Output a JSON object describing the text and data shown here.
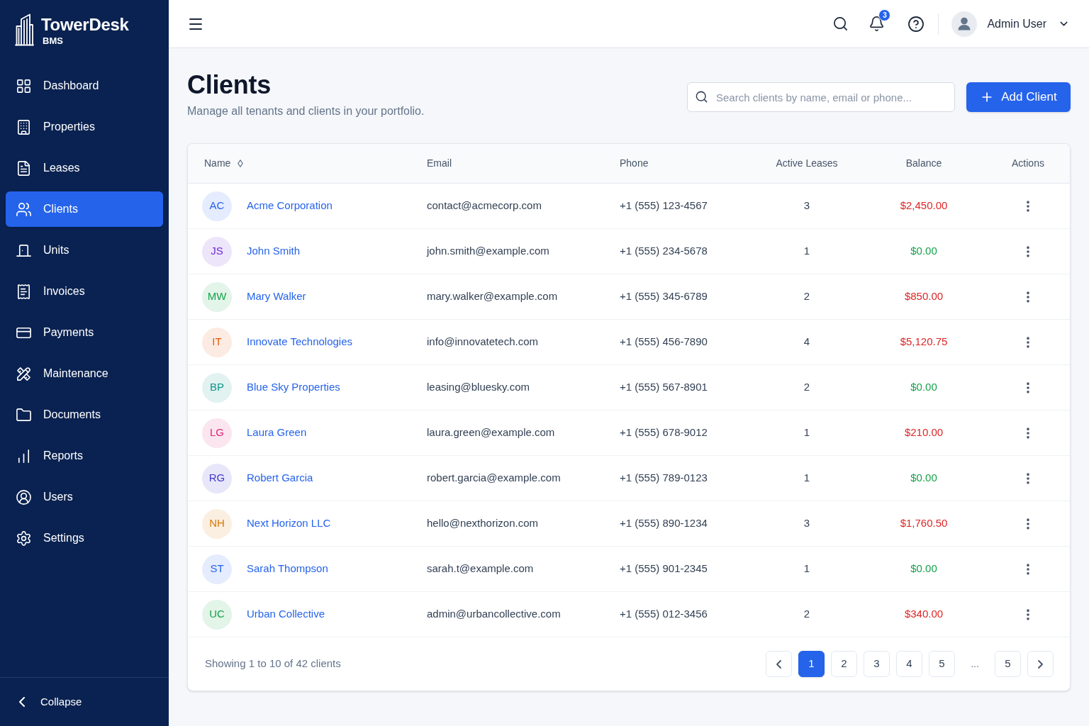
{
  "sidebar": {
    "brand": {
      "name": "TowerDesk",
      "subtitle": "BMS"
    },
    "items": [
      {
        "label": "Dashboard",
        "selected": false
      },
      {
        "label": "Properties",
        "selected": false
      },
      {
        "label": "Leases",
        "selected": false
      },
      {
        "label": "Clients",
        "selected": true
      },
      {
        "label": "Units",
        "selected": false
      },
      {
        "label": "Invoices",
        "selected": false
      },
      {
        "label": "Payments",
        "selected": false
      },
      {
        "label": "Maintenance",
        "selected": false
      },
      {
        "label": "Documents",
        "selected": false
      },
      {
        "label": "Reports",
        "selected": false
      },
      {
        "label": "Users",
        "selected": false
      },
      {
        "label": "Settings",
        "selected": false
      }
    ],
    "collapse": {
      "label": "Collapse"
    }
  },
  "header": {
    "notification_count": "3",
    "user": {
      "name": "Admin User"
    }
  },
  "page": {
    "title": "Clients",
    "subtitle": "Manage all tenants and clients in your portfolio.",
    "search": {
      "placeholder": "Search clients by name, email or phone..."
    },
    "add_button": {
      "label": "Add Client"
    }
  },
  "table": {
    "columns": [
      {
        "label": "Name",
        "sortable": true
      },
      {
        "label": "Email",
        "sortable": false
      },
      {
        "label": "Phone",
        "sortable": false
      },
      {
        "label": "Active Leases",
        "sortable": false
      },
      {
        "label": "Balance",
        "sortable": false
      },
      {
        "label": "Actions",
        "sortable": false
      }
    ],
    "rows": [
      {
        "initials": "AC",
        "color": "#2563eb",
        "name": "Acme Corporation",
        "email": "contact@acmecorp.com",
        "phone": "+1 (555) 123-4567",
        "active_leases": "3",
        "balance": "$2,450.00",
        "outstanding": true
      },
      {
        "initials": "JS",
        "color": "#6d28d9",
        "name": "John Smith",
        "email": "john.smith@example.com",
        "phone": "+1 (555) 234-5678",
        "active_leases": "1",
        "balance": "$0.00",
        "outstanding": false
      },
      {
        "initials": "MW",
        "color": "#16a34a",
        "name": "Mary Walker",
        "email": "mary.walker@example.com",
        "phone": "+1 (555) 345-6789",
        "active_leases": "2",
        "balance": "$850.00",
        "outstanding": true
      },
      {
        "initials": "IT",
        "color": "#ea580c",
        "name": "Innovate Technologies",
        "email": "info@innovatetech.com",
        "phone": "+1 (555) 456-7890",
        "active_leases": "4",
        "balance": "$5,120.75",
        "outstanding": true
      },
      {
        "initials": "BP",
        "color": "#0d9488",
        "name": "Blue Sky Properties",
        "email": "leasing@bluesky.com",
        "phone": "+1 (555) 567-8901",
        "active_leases": "2",
        "balance": "$0.00",
        "outstanding": false
      },
      {
        "initials": "LG",
        "color": "#db2777",
        "name": "Laura Green",
        "email": "laura.green@example.com",
        "phone": "+1 (555) 678-9012",
        "active_leases": "1",
        "balance": "$210.00",
        "outstanding": true
      },
      {
        "initials": "RG",
        "color": "#4338ca",
        "name": "Robert Garcia",
        "email": "robert.garcia@example.com",
        "phone": "+1 (555) 789-0123",
        "active_leases": "1",
        "balance": "$0.00",
        "outstanding": false
      },
      {
        "initials": "NH",
        "color": "#d97706",
        "name": "Next Horizon LLC",
        "email": "hello@nexthorizon.com",
        "phone": "+1 (555) 890-1234",
        "active_leases": "3",
        "balance": "$1,760.50",
        "outstanding": true
      },
      {
        "initials": "ST",
        "color": "#2563eb",
        "name": "Sarah Thompson",
        "email": "sarah.t@example.com",
        "phone": "+1 (555) 901-2345",
        "active_leases": "1",
        "balance": "$0.00",
        "outstanding": false
      },
      {
        "initials": "UC",
        "color": "#16a34a",
        "name": "Urban Collective",
        "email": "admin@urbancollective.com",
        "phone": "+1 (555) 012-3456",
        "active_leases": "2",
        "balance": "$340.00",
        "outstanding": true
      }
    ]
  },
  "footer": {
    "summary": "Showing 1 to 10 of 42 clients",
    "pages": [
      {
        "kind": "page",
        "label": "1",
        "selected": true
      },
      {
        "kind": "page",
        "label": "2",
        "selected": false
      },
      {
        "kind": "page",
        "label": "3",
        "selected": false
      },
      {
        "kind": "page",
        "label": "4",
        "selected": false
      },
      {
        "kind": "page",
        "label": "5",
        "selected": false
      },
      {
        "kind": "ellipsis",
        "label": "...",
        "selected": false
      },
      {
        "kind": "page",
        "label": "5",
        "selected": false
      }
    ]
  }
}
